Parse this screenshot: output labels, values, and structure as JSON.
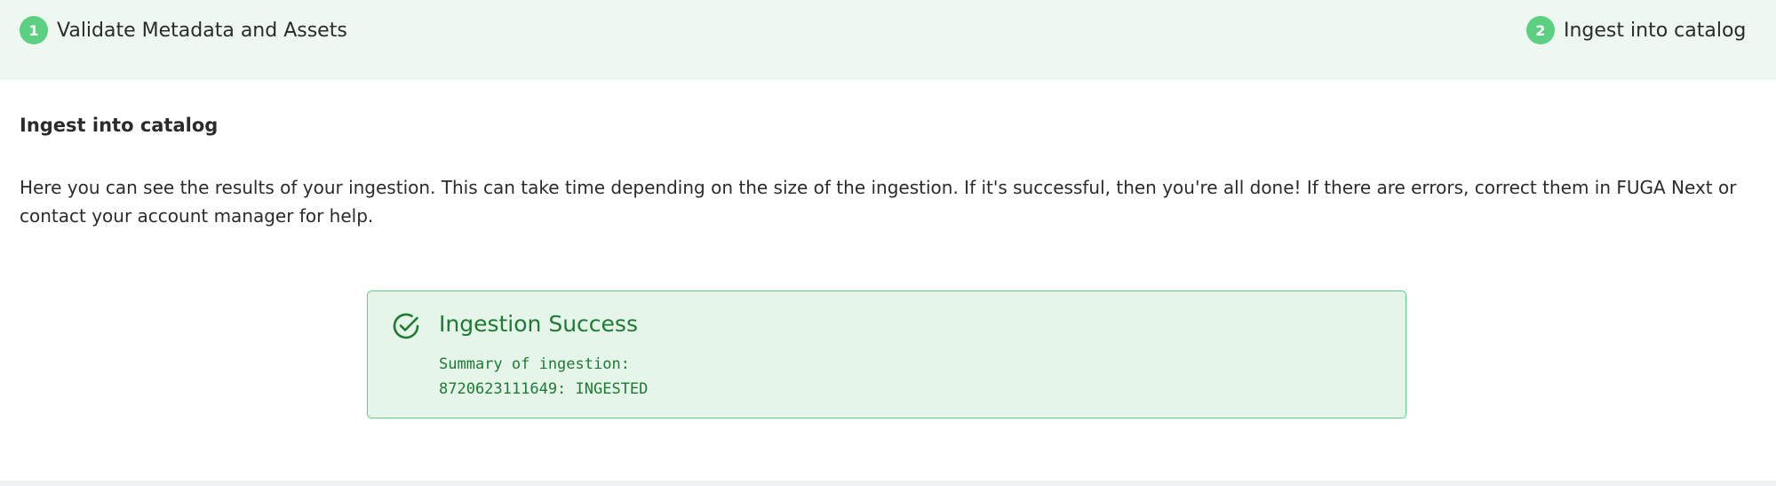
{
  "stepper": {
    "steps": [
      {
        "number": "1",
        "label": "Validate Metadata and Assets"
      },
      {
        "number": "2",
        "label": "Ingest into catalog"
      }
    ]
  },
  "main": {
    "title": "Ingest into catalog",
    "description": "Here you can see the results of your ingestion. This can take time depending on the size of the ingestion. If it's successful, then you're all done! If there are errors, correct them in FUGA Next or contact your account manager for help."
  },
  "alert": {
    "icon": "check-circle-icon",
    "title": "Ingestion Success",
    "summary_label": "Summary of ingestion:",
    "summary_line": "8720623111649: INGESTED"
  },
  "colors": {
    "accent": "#5ccf83",
    "header_bg": "#eef8f1",
    "alert_bg": "#e5f5e9",
    "alert_text": "#1e7a34"
  }
}
